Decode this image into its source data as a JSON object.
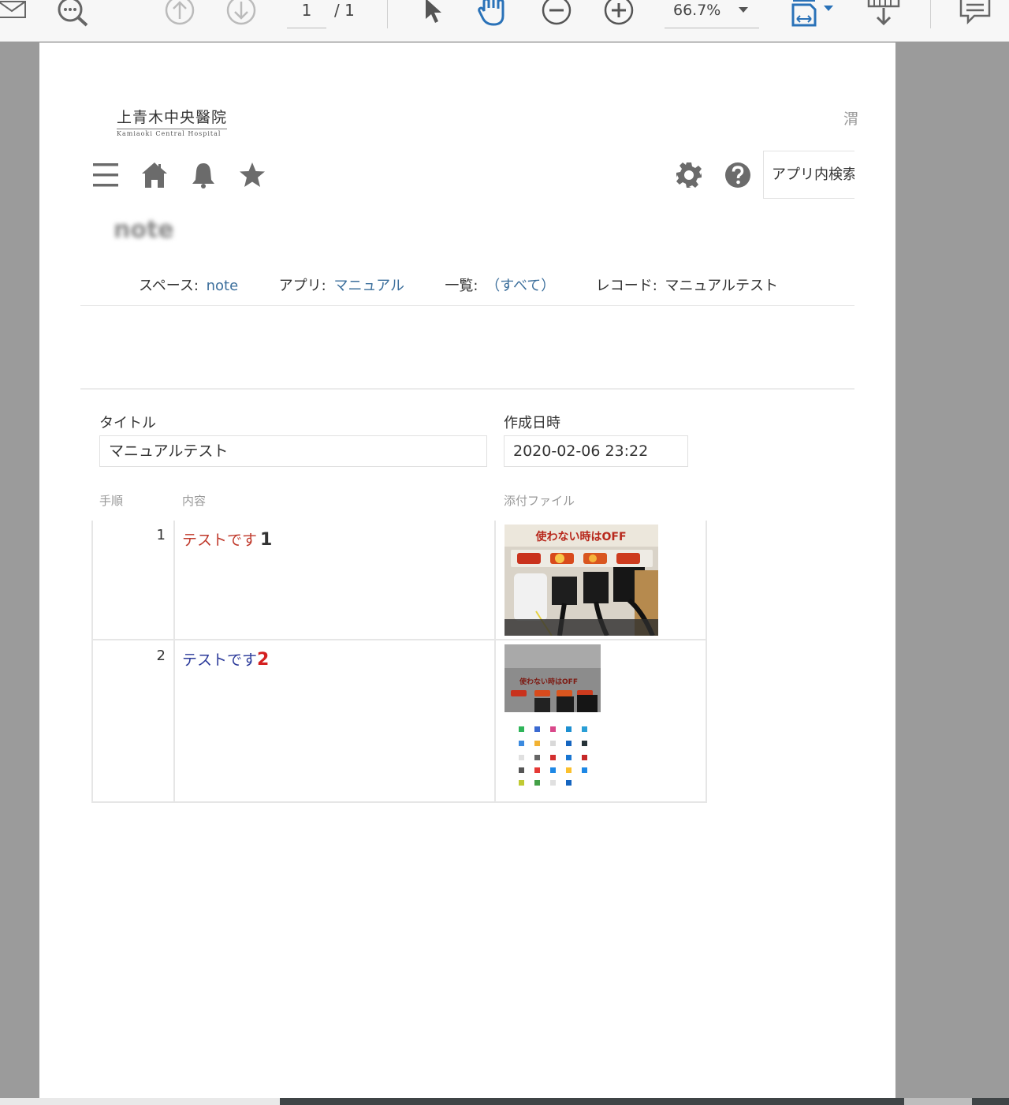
{
  "toolbar": {
    "page_current": "1",
    "page_total": "/ 1",
    "zoom": "66.7%"
  },
  "document": {
    "logo_main": "上青木中央醫院",
    "logo_sub": "Kamiaoki Central Hospital",
    "corner_text": "渭",
    "search_placeholder": "アプリ内検索",
    "space_title": "note",
    "breadcrumb": {
      "space_label": "スペース:",
      "space_value": "note",
      "app_label": "アプリ:",
      "app_value": "マニュアル",
      "list_label": "一覧:",
      "list_value": "（すべて）",
      "record_label": "レコード:",
      "record_value": "マニュアルテスト"
    },
    "fields": {
      "title_label": "タイトル",
      "title_value": "マニュアルテスト",
      "created_label": "作成日時",
      "created_value": "2020-02-06 23:22"
    },
    "table": {
      "headers": [
        "手順",
        "内容",
        "添付ファイル"
      ],
      "rows": [
        {
          "step": "1",
          "content_text": "テストです",
          "content_num": "1",
          "image_caption": "使わない時はOFF"
        },
        {
          "step": "2",
          "content_text": "テストです",
          "content_num": "2",
          "image_caption": "使わない時はOFF"
        }
      ]
    }
  },
  "colors": {
    "link": "#3c6f9c",
    "toolbar_bg": "#f7f7f7",
    "viewer_bg": "#9b9b9b",
    "active_icon": "#2a72b8"
  }
}
